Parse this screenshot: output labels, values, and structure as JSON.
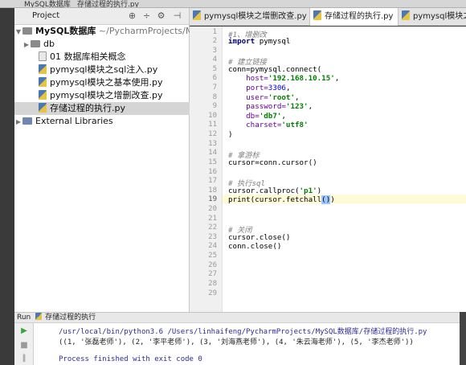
{
  "window": {
    "title": "MySQL数据库",
    "file_title": "存储过程的执行.py"
  },
  "project_panel": {
    "label": "Project",
    "root": {
      "name": "MySQL数据库",
      "path": "~/PycharmProjects/MyS"
    },
    "items": [
      {
        "name": "db",
        "type": "folder"
      },
      {
        "name": "01 数据库相关概念",
        "type": "txt"
      },
      {
        "name": "pymysql模块之sql注入.py",
        "type": "py"
      },
      {
        "name": "pymysql模块之基本使用.py",
        "type": "py"
      },
      {
        "name": "pymysql模块之增删改查.py",
        "type": "py"
      },
      {
        "name": "存储过程的执行.py",
        "type": "py",
        "selected": true
      },
      {
        "name": "External Libraries",
        "type": "lib"
      }
    ]
  },
  "tabs": [
    {
      "label": "pymysql模块之增删改查.py",
      "active": false
    },
    {
      "label": "存储过程的执行.py",
      "active": true
    },
    {
      "label": "pymysql模块之基",
      "active": false
    }
  ],
  "editor": {
    "line_numbers": [
      "1",
      "2",
      "3",
      "4",
      "5",
      "6",
      "7",
      "8",
      "9",
      "10",
      "11",
      "12",
      "13",
      "14",
      "15",
      "16",
      "17",
      "18",
      "19",
      "20",
      "21",
      "22",
      "23",
      "24",
      "25",
      "26",
      "27",
      "28",
      "29"
    ],
    "lines": {
      "l1": "#1、增删改",
      "l2_kw": "import",
      "l2_rest": " pymysql",
      "l4": "# 建立链接",
      "l5": "conn=pymysql.connect(",
      "l6_k": "    host=",
      "l6_v": "'192.168.10.15'",
      "l7_k": "    port=",
      "l7_v": "3306",
      "l8_k": "    user=",
      "l8_v": "'root'",
      "l9_k": "    password=",
      "l9_v": "'123'",
      "l10_k": "    db=",
      "l10_v": "'db7'",
      "l11_k": "    charset=",
      "l11_v": "'utf8'",
      "l12": ")",
      "l14": "# 拿游标",
      "l15": "cursor=conn.cursor()",
      "l17": "# 执行sql",
      "l18_a": "cursor.callproc(",
      "l18_s": "'p1'",
      "l18_b": ")",
      "l19_a": "print(cursor.fetchall",
      "l19_h": "()",
      "l19_b": ")",
      "l22": "# 关闭",
      "l23": "cursor.close()",
      "l24": "conn.close()"
    }
  },
  "run_panel": {
    "label": "Run",
    "config": "存储过程的执行",
    "output": [
      "/usr/local/bin/python3.6 /Users/linhaifeng/PycharmProjects/MySQL数据库/存储过程的执行.py",
      "((1, '张磊老师'), (2, '李平老师'), (3, '刘海燕老师'), (4, '朱云海老师'), (5, '李杰老师'))",
      "",
      "Process finished with exit code 0"
    ]
  }
}
